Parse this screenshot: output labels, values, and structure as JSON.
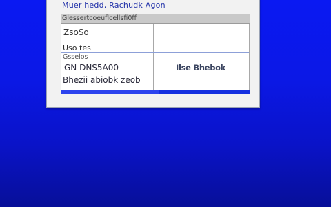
{
  "window": {
    "title": "Muer hedd, Rachudk Agon",
    "subheader": "Glessertcoeuflcellsfi0ff",
    "rows": [
      {
        "text": "ZsoSo"
      },
      {
        "text": "Uso tes",
        "suffix": "+"
      },
      {
        "text": "Gsselos"
      },
      {
        "left": "GN DNS5A00",
        "right": "Ilse Bhebok"
      },
      {
        "text": "Bhezii abiobk zeob"
      }
    ]
  },
  "colors": {
    "desktop_background": "#0a19f2",
    "title_text": "#1f2fa8",
    "selection_bar": "#1530e0"
  }
}
